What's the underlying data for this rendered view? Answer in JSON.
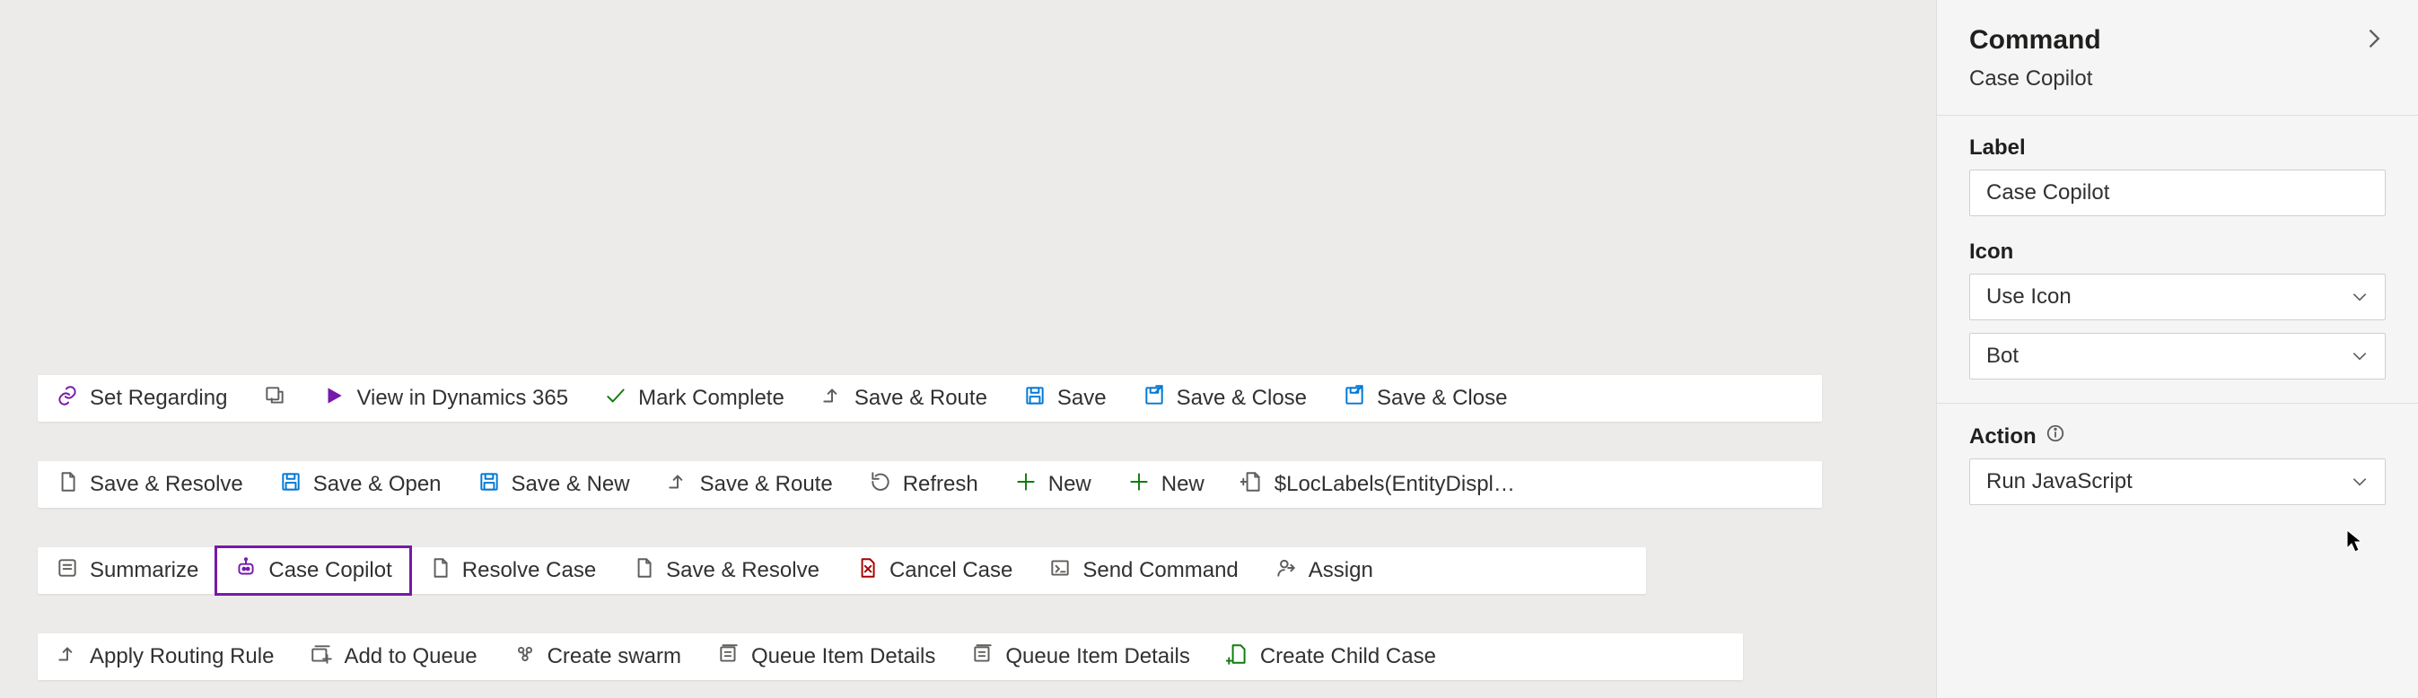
{
  "toolbars": {
    "row1": [
      {
        "icon": "link",
        "label": "Set Regarding",
        "color": "purple"
      },
      {
        "icon": "popout",
        "label": "",
        "color": "gray"
      },
      {
        "icon": "play",
        "label": "View in Dynamics 365",
        "color": "purple"
      },
      {
        "icon": "check",
        "label": "Mark Complete",
        "color": "green"
      },
      {
        "icon": "route",
        "label": "Save & Route",
        "color": "gray"
      },
      {
        "icon": "save",
        "label": "Save",
        "color": "blue"
      },
      {
        "icon": "saveclose",
        "label": "Save & Close",
        "color": "blue"
      },
      {
        "icon": "saveclose",
        "label": "Save & Close",
        "color": "blue"
      }
    ],
    "row2": [
      {
        "icon": "page",
        "label": "Save & Resolve",
        "color": "gray"
      },
      {
        "icon": "save",
        "label": "Save & Open",
        "color": "blue"
      },
      {
        "icon": "save",
        "label": "Save & New",
        "color": "blue"
      },
      {
        "icon": "route",
        "label": "Save & Route",
        "color": "gray"
      },
      {
        "icon": "refresh",
        "label": "Refresh",
        "color": "gray"
      },
      {
        "icon": "plus",
        "label": "New",
        "color": "green"
      },
      {
        "icon": "plus",
        "label": "New",
        "color": "green"
      },
      {
        "icon": "newpage",
        "label": "$LocLabels(EntityDispl…",
        "color": "gray",
        "ellipsis": true
      }
    ],
    "row3": [
      {
        "icon": "summarize",
        "label": "Summarize",
        "color": "gray"
      },
      {
        "icon": "bot",
        "label": "Case Copilot",
        "color": "purple",
        "selected": true
      },
      {
        "icon": "page",
        "label": "Resolve Case",
        "color": "gray"
      },
      {
        "icon": "page",
        "label": "Save & Resolve",
        "color": "gray"
      },
      {
        "icon": "cancelpage",
        "label": "Cancel Case",
        "color": "red"
      },
      {
        "icon": "sendcmd",
        "label": "Send Command",
        "color": "gray"
      },
      {
        "icon": "assign",
        "label": "Assign",
        "color": "gray"
      }
    ],
    "row4": [
      {
        "icon": "route",
        "label": "Apply Routing Rule",
        "color": "gray"
      },
      {
        "icon": "addqueue",
        "label": "Add to Queue",
        "color": "gray"
      },
      {
        "icon": "swarm",
        "label": "Create swarm",
        "color": "gray"
      },
      {
        "icon": "queuedetails",
        "label": "Queue Item Details",
        "color": "gray"
      },
      {
        "icon": "queuedetails",
        "label": "Queue Item Details",
        "color": "gray"
      },
      {
        "icon": "childcase",
        "label": "Create Child Case",
        "color": "green"
      }
    ]
  },
  "panel": {
    "header_title": "Command",
    "header_sub": "Case Copilot",
    "label_field_label": "Label",
    "label_field_value": "Case Copilot",
    "icon_field_label": "Icon",
    "icon_select_value": "Use Icon",
    "icon_select_value2": "Bot",
    "action_field_label": "Action",
    "action_select_value": "Run JavaScript"
  }
}
